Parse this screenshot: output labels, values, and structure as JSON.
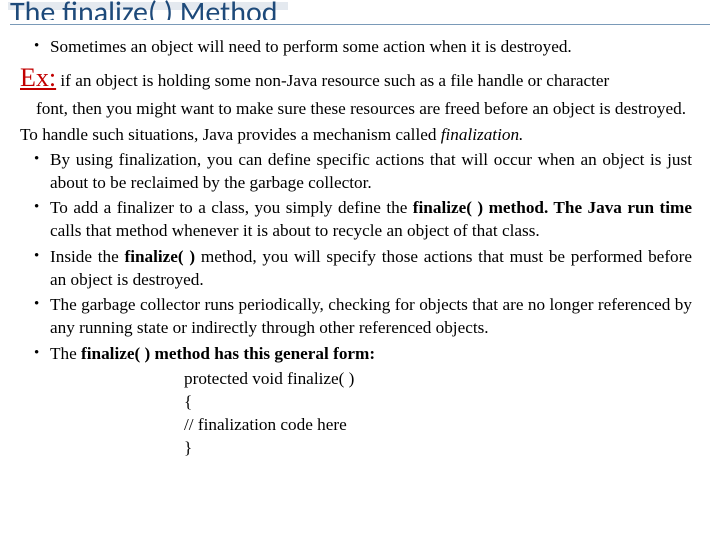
{
  "title": "The finalize( ) Method",
  "bullet1": "Sometimes an object will need to perform some action when it is destroyed.",
  "ex": {
    "label": "Ex:",
    "tail": " if an object is holding some non-Java resource such as a file handle or character",
    "cont": "font, then you might want to make sure these resources are freed before an object is destroyed."
  },
  "handle_line_pre": "To handle such situations, Java provides a mechanism called ",
  "handle_line_em": "finalization.",
  "bullet2": "By using finalization, you can define specific actions that will occur when an object is just about to be reclaimed by the garbage collector.",
  "bullet3_pre": "To add a finalizer to a class, you simply define the ",
  "bullet3_b1": "finalize( ) method. The Java run time ",
  "bullet3_post": "calls that method whenever it is about to recycle an object of that class.",
  "bullet4_pre": "Inside the ",
  "bullet4_b": "finalize( )",
  "bullet4_post": " method, you will specify those actions that must be performed before an object is destroyed.",
  "bullet5": "The garbage collector runs periodically, checking for objects that are no longer referenced by any running state or indirectly through other referenced objects.",
  "bullet6_pre": "The ",
  "bullet6_b": "finalize( ) method has this general form:",
  "code": {
    "l1": "protected void finalize( )",
    "l2": "{",
    "l3": "   // finalization code here",
    "l4": "}"
  }
}
